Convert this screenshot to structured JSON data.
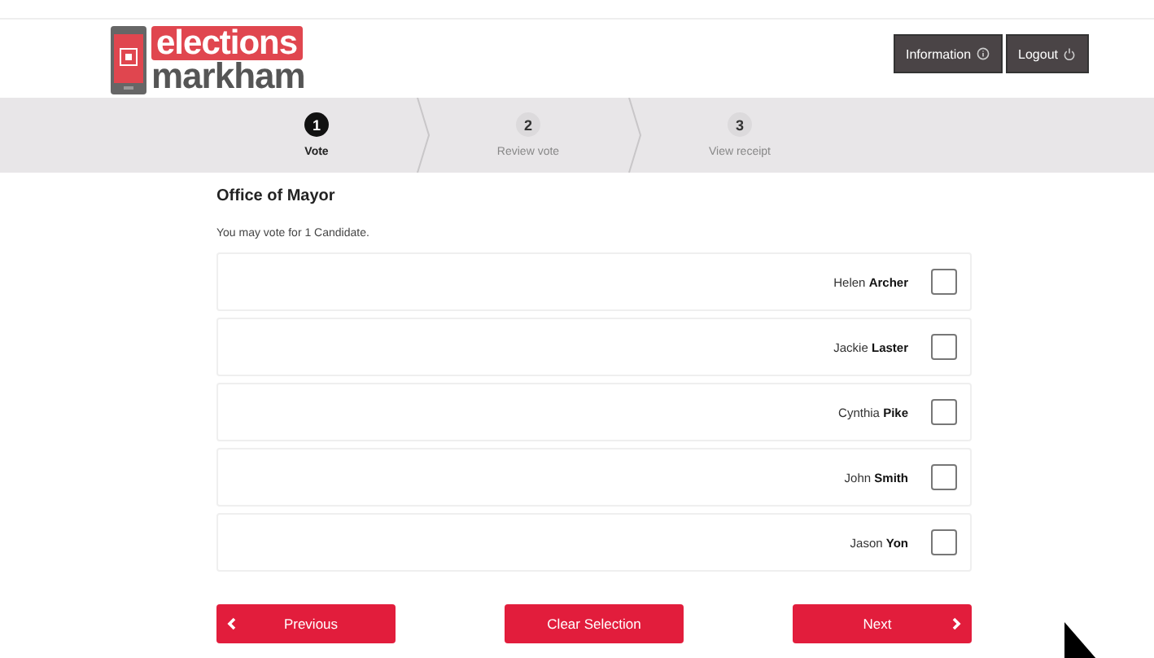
{
  "header": {
    "logo": {
      "top": "elections",
      "bottom": "markham"
    },
    "buttons": [
      {
        "label": "Information",
        "kind": "info"
      },
      {
        "label": "Logout",
        "kind": "power"
      }
    ]
  },
  "steps": [
    {
      "number": "1",
      "label": "Vote",
      "selected": true
    },
    {
      "number": "2",
      "label": "Review vote",
      "selected": false
    },
    {
      "number": "3",
      "label": "View receipt",
      "selected": false
    }
  ],
  "contest": {
    "title": "Office of Mayor",
    "instruction": "You may vote for 1 Candidate.",
    "candidates": [
      {
        "first": "Helen",
        "last": "Archer",
        "checked": false
      },
      {
        "first": "Jackie",
        "last": "Laster",
        "checked": false
      },
      {
        "first": "Cynthia",
        "last": "Pike",
        "checked": false
      },
      {
        "first": "John",
        "last": "Smith",
        "checked": false
      },
      {
        "first": "Jason",
        "last": "Yon",
        "checked": false
      }
    ]
  },
  "footer_buttons": [
    {
      "label": "Previous",
      "kind": "back"
    },
    {
      "label": "Clear Selection",
      "kind": "plain"
    },
    {
      "label": "Next",
      "kind": "forward"
    }
  ]
}
